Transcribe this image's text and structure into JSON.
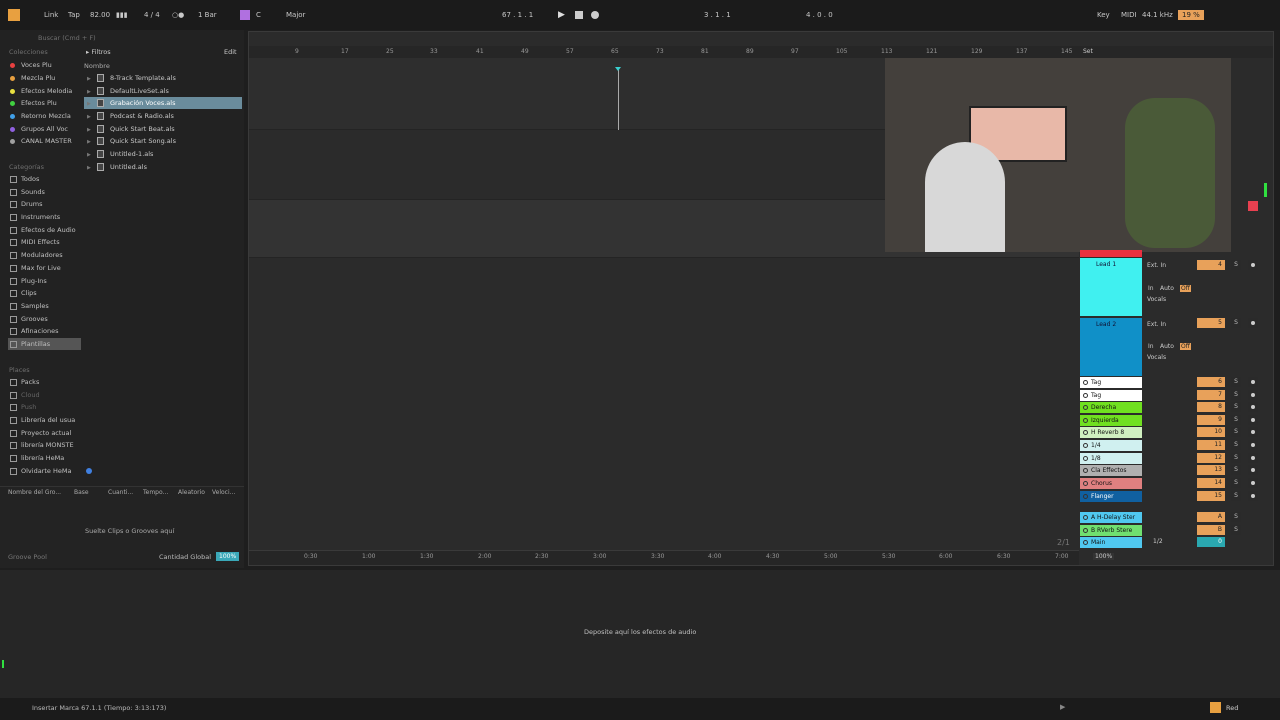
{
  "topbar": {
    "link": "Link",
    "tap": "Tap",
    "tempo": "82.00",
    "sig": "4 / 4",
    "quant": "1 Bar",
    "key": "C",
    "scale": "Major",
    "pos": "67 .  1 .  1",
    "loop_start": "3 .  1 .  1",
    "loop_len": "4 .  0 .  0",
    "key_label": "Key",
    "midi_label": "MIDI",
    "samplerate": "44.1 kHz",
    "cpu": "19 %"
  },
  "browser": {
    "search_placeholder": "Buscar (Cmd + F)",
    "filters": "Filtros",
    "edit": "Edit",
    "col_name": "Nombre",
    "collections_title": "Colecciones",
    "collections": [
      {
        "label": "Voces Plu",
        "color": "#e84040"
      },
      {
        "label": "Mezcla Plu",
        "color": "#e8a040"
      },
      {
        "label": "Efectos Melodia",
        "color": "#e8e040"
      },
      {
        "label": "Efectos Plu",
        "color": "#40d040"
      },
      {
        "label": "Retorno Mezcla",
        "color": "#40a0e8"
      },
      {
        "label": "Grupos All Voc",
        "color": "#9060e0"
      },
      {
        "label": "CANAL MASTER",
        "color": "#a0a0a0"
      }
    ],
    "categories_title": "Categorías",
    "categories": [
      "Todos",
      "Sounds",
      "Drums",
      "Instruments",
      "Efectos de Audio",
      "MIDI Effects",
      "Moduladores",
      "Max for Live",
      "Plug-Ins",
      "Clips",
      "Samples",
      "Grooves",
      "Afinaciones",
      "Plantillas"
    ],
    "places_title": "Places",
    "places": [
      "Packs",
      "Cloud",
      "Push",
      "Librería del usua",
      "Proyecto actual",
      "librería MONSTE",
      "librería HeMa",
      "Olvidarte HeMa"
    ],
    "files": [
      "8-Track Template.als",
      "DefaultLiveSet.als",
      "Grabación Voces.als",
      "Podcast & Radio.als",
      "Quick Start Beat.als",
      "Quick Start Song.als",
      "Untitled-1.als",
      "Untitled.als"
    ],
    "groove_cols": [
      "Nombre del Gro...",
      "Base",
      "Cuanti...",
      "Tempo...",
      "Aleatorio",
      "Veloci..."
    ],
    "groove_hint": "Suelte Clips o Grooves aquí",
    "groove_pool": "Groove Pool",
    "global_amount": "Cantidad Global",
    "global_value": "100%"
  },
  "arrangement": {
    "bars": [
      "9",
      "17",
      "25",
      "33",
      "41",
      "49",
      "57",
      "65",
      "73",
      "81",
      "89",
      "97",
      "105",
      "113",
      "121",
      "129",
      "137",
      "145"
    ],
    "set_label": "Set",
    "times": [
      "0:30",
      "1:00",
      "1:30",
      "2:00",
      "2:30",
      "3:00",
      "3:30",
      "4:00",
      "4:30",
      "5:00",
      "5:30",
      "6:00",
      "6:30",
      "7:00"
    ],
    "page": "2/1",
    "zoom": "100%",
    "ext_in": "Ext. In",
    "auto": "Auto",
    "off": "Off",
    "in": "In",
    "vocals": "Vocals",
    "minus_inf": "-∞",
    "tracks": [
      {
        "name": "Lead 1",
        "color": "#40f0f0",
        "num": "4"
      },
      {
        "name": "Lead 2",
        "color": "#1090c8",
        "num": "5"
      },
      {
        "name": "Tag",
        "color": "#ffffff",
        "num": "6"
      },
      {
        "name": "Tag",
        "color": "#ffffff",
        "num": "7"
      },
      {
        "name": "Derecha",
        "color": "#70e020",
        "num": "8"
      },
      {
        "name": "Izquierda",
        "color": "#70e020",
        "num": "9"
      },
      {
        "name": "H Reverb 8",
        "color": "#d0f0c0",
        "num": "10"
      },
      {
        "name": "1/4",
        "color": "#d0f0f0",
        "num": "11"
      },
      {
        "name": "1/8",
        "color": "#d0f0f0",
        "num": "12"
      },
      {
        "name": "Cla Effectos",
        "color": "#b0b0b0",
        "num": "13"
      },
      {
        "name": "Chorus",
        "color": "#e08080",
        "num": "14"
      },
      {
        "name": "Flanger",
        "color": "#1060a0",
        "num": "15"
      },
      {
        "name": "A H-Delay Ster",
        "color": "#50c8f0",
        "num": "A"
      },
      {
        "name": "B RVerb Stere",
        "color": "#70e070",
        "num": "B"
      },
      {
        "name": "Main",
        "color": "#50c8f0",
        "num": "0"
      }
    ],
    "main_out": "1/2"
  },
  "device": {
    "drop_hint": "Deposite aquí los efectos de audio"
  },
  "status": {
    "message": "Insertar Marca 67.1.1 (Tiempo: 3:13:173)",
    "device_name": "Red"
  }
}
